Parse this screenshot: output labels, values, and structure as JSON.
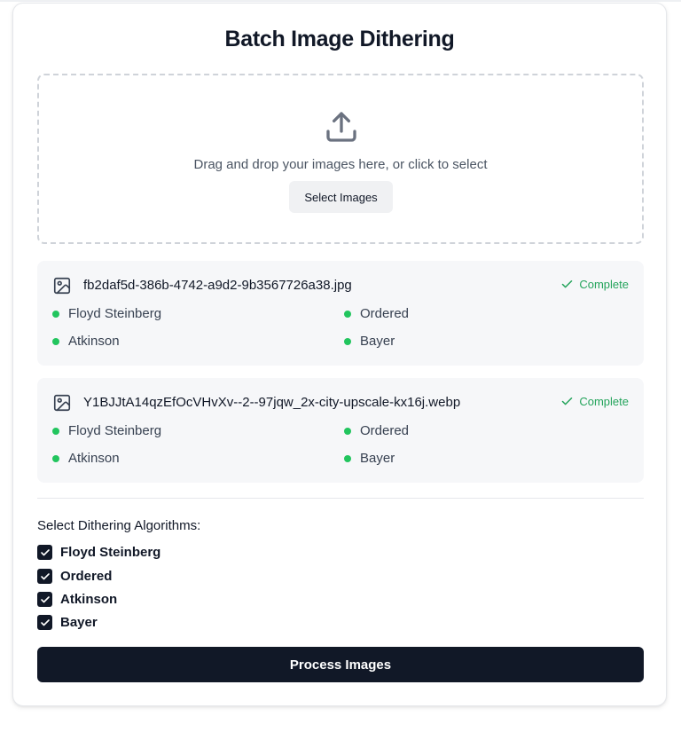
{
  "title": "Batch Image Dithering",
  "dropzone": {
    "text": "Drag and drop your images here, or click to select",
    "button_label": "Select Images",
    "icon": "upload-icon"
  },
  "files": [
    {
      "name": "fb2daf5d-386b-4742-a9d2-9b3567726a38.jpg",
      "status": "Complete",
      "algorithms": [
        "Floyd Steinberg",
        "Ordered",
        "Atkinson",
        "Bayer"
      ]
    },
    {
      "name": "Y1BJJtA14qzEfOcVHvXv--2--97jqw_2x-city-upscale-kx16j.webp",
      "status": "Complete",
      "algorithms": [
        "Floyd Steinberg",
        "Ordered",
        "Atkinson",
        "Bayer"
      ]
    }
  ],
  "algorithm_section": {
    "label": "Select Dithering Algorithms:",
    "options": [
      {
        "label": "Floyd Steinberg",
        "checked": true
      },
      {
        "label": "Ordered",
        "checked": true
      },
      {
        "label": "Atkinson",
        "checked": true
      },
      {
        "label": "Bayer",
        "checked": true
      }
    ]
  },
  "process_button_label": "Process Images",
  "colors": {
    "accent": "#111827",
    "success": "#22c55e",
    "success_text": "#22a35a",
    "file_card_bg": "#f6f7f9"
  }
}
